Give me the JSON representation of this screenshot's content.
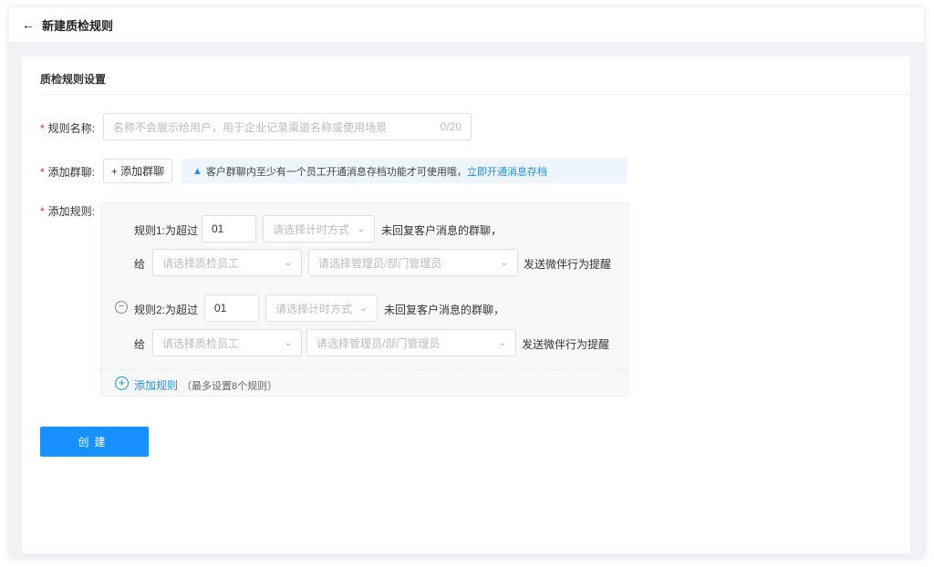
{
  "header": {
    "title": "新建质检规则"
  },
  "section": {
    "title": "质检规则设置"
  },
  "form": {
    "name_label": "规则名称:",
    "name_placeholder": "名称不会展示给用户，用于企业记录渠道名称或使用场景",
    "name_count": "0/20",
    "group_label": "添加群聊:",
    "add_group_button": "+ 添加群聊",
    "tip_text": "客户群聊内至少有一个员工开通消息存档功能才可使用哦，",
    "tip_link": "立即开通消息存档",
    "rules_label": "添加规则:"
  },
  "rules": [
    {
      "prefix": "规则1:为超过",
      "value": "01",
      "timing_placeholder": "请选择计时方式",
      "suffix": "未回复客户消息的群聊，",
      "give": "给",
      "staff_placeholder": "请选择质检员工",
      "admin_placeholder": "请选择管理员/部门管理员",
      "action": "发送微伴行为提醒"
    },
    {
      "prefix": "规则2:为超过",
      "value": "01",
      "timing_placeholder": "请选择计时方式",
      "suffix": "未回复客户消息的群聊，",
      "give": "给",
      "staff_placeholder": "请选择质检员工",
      "admin_placeholder": "请选择管理员/部门管理员",
      "action": "发送微伴行为提醒"
    }
  ],
  "add_rule": {
    "label": "添加规则",
    "hint": "（最多设置8个规则）"
  },
  "create_button": "创建"
}
